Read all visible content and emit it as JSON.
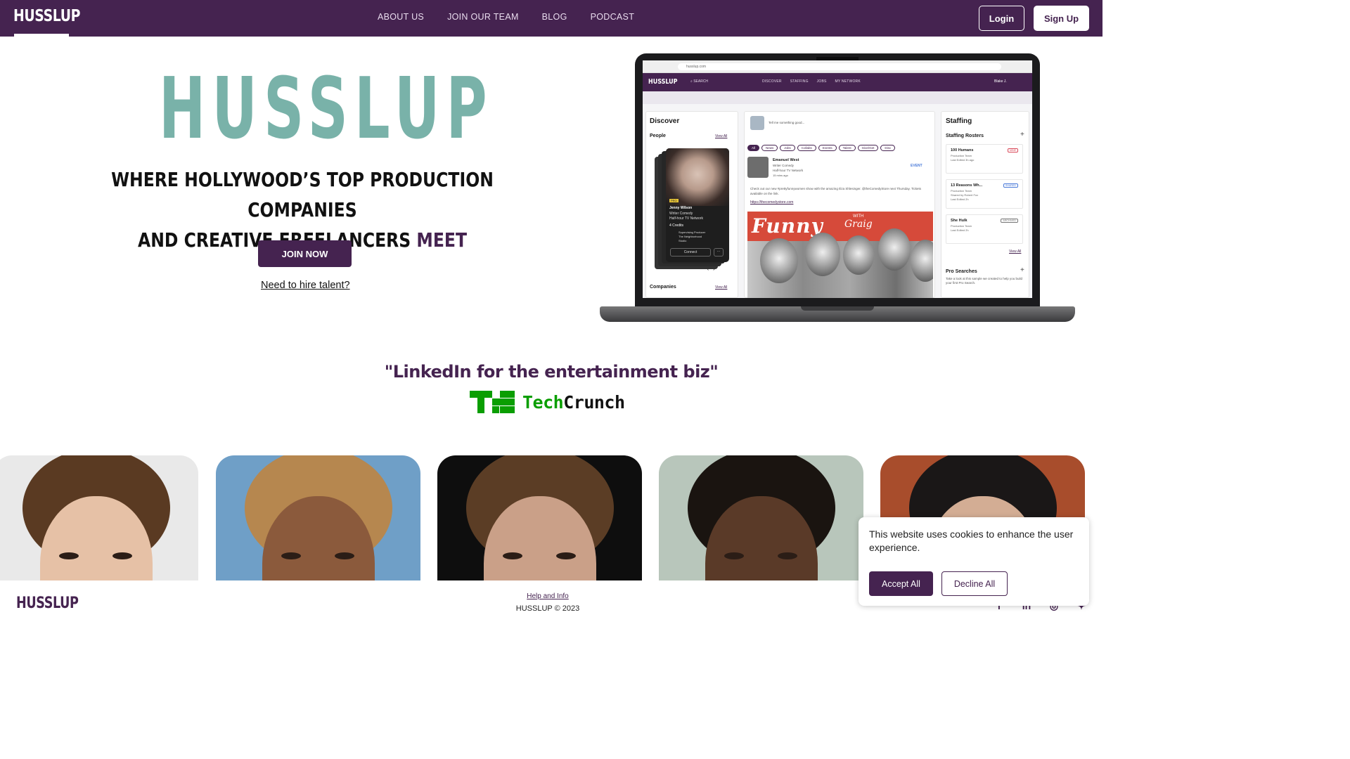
{
  "nav": {
    "logo": "HUSSLUP",
    "links": [
      "ABOUT US",
      "JOIN OUR TEAM",
      "BLOG",
      "PODCAST"
    ],
    "login": "Login",
    "signup": "Sign Up"
  },
  "hero": {
    "wordmark": "HUSSLUP",
    "tagline_line1": "WHERE HOLLYWOOD’S TOP PRODUCTION COMPANIES",
    "tagline_line2": "AND CREATIVE FREELANCERS",
    "tagline_accent": "MEET",
    "join_button": "JOIN NOW",
    "hire_link": "Need to hire talent?"
  },
  "app_preview": {
    "url": "husslup.com",
    "logo": "HUSSLUP",
    "search": "SEARCH",
    "nav": [
      "DISCOVER",
      "STAFFING",
      "JOBS",
      "MY NETWORK"
    ],
    "user": "Blake J.",
    "discover": {
      "title": "Discover",
      "people": "People",
      "view_all": "View All",
      "person_badge": "PRO",
      "person_name": "Jenny Wilson",
      "person_role": "Writer Comedy",
      "person_company": "Half-hour TV Network",
      "person_credits": "4 Credits",
      "credit_role": "Supervising Producer",
      "credit_show": "The Neighborhood",
      "credit_studio": "Studio",
      "connect": "Connect",
      "companies": "Companies",
      "companies_view_all": "View All"
    },
    "feed": {
      "placeholder": "Tell me something good...",
      "chips": [
        "All",
        "News",
        "Jobs",
        "Collabs",
        "Events",
        "Talent",
        "Give/Get",
        "Disc"
      ],
      "post_name": "Emanuel West",
      "post_role": "Writer Comedy",
      "post_company": "Half-hour TV Network",
      "post_time": "15 mins ago",
      "post_tag": "EVENT",
      "post_text": "Check out our new #prettyfunnywomen show with the amazing Iliza Shlesinger. @theComedyStore next Thursday. Tickets available on the link.",
      "post_link": "https://thecomedystore.com",
      "image_title": "Funny",
      "image_sub_small": "WITH",
      "image_sub": "Graig"
    },
    "staffing": {
      "title": "Staffing",
      "rosters_title": "Staffing Rosters",
      "rosters": [
        {
          "name": "100 Humans",
          "team": "Production Team",
          "meta": "Last Edited 3h ago",
          "tag": "MINE",
          "tag_color": "#d94a5a"
        },
        {
          "name": "13 Reasons Wh...",
          "team": "Production Team",
          "meta": "Shared by Robert Fox",
          "meta2": "Last Edited 2h",
          "tag": "SHARED",
          "tag_color": "#4a7ad9"
        },
        {
          "name": "She Hulk",
          "team": "Production Team",
          "meta": "Last Edited 2h",
          "tag": "ARCHIVED",
          "tag_color": "#777777"
        }
      ],
      "view_all": "View All",
      "pro_title": "Pro Searches",
      "pro_text": "Take a look at this sample we created to help you build your first Pro Search."
    }
  },
  "press": {
    "quote": "\"LinkedIn for the entertainment biz\"",
    "source_tech": "Tech",
    "source_crunch": "Crunch"
  },
  "talent_photos": [
    {
      "bg": "#e9e9e9",
      "hair": "#5a3a22",
      "skin": "#e6c1a6"
    },
    {
      "bg": "#6f9fc7",
      "hair": "#b6874f",
      "skin": "#8b5a3c"
    },
    {
      "bg": "#0e0e0e",
      "hair": "#5b3d25",
      "skin": "#caa088"
    },
    {
      "bg": "#b8c6bb",
      "hair": "#1a1410",
      "skin": "#5a3a28"
    },
    {
      "bg": "#a84d2c",
      "hair": "#1a1717",
      "skin": "#d3ad94"
    }
  ],
  "footer": {
    "logo": "HUSSLUP",
    "help": "Help and Info",
    "copyright": "HUSSLUP © 2023",
    "social": [
      "facebook-icon",
      "linkedin-icon",
      "instagram-icon",
      "twitter-icon"
    ]
  },
  "cookie": {
    "text": "This website uses cookies to enhance the user experience.",
    "accept": "Accept All",
    "decline": "Decline All"
  },
  "colors": {
    "brand_purple": "#452350",
    "brand_teal": "#79b2a9",
    "techcrunch_green": "#0a9e01"
  }
}
